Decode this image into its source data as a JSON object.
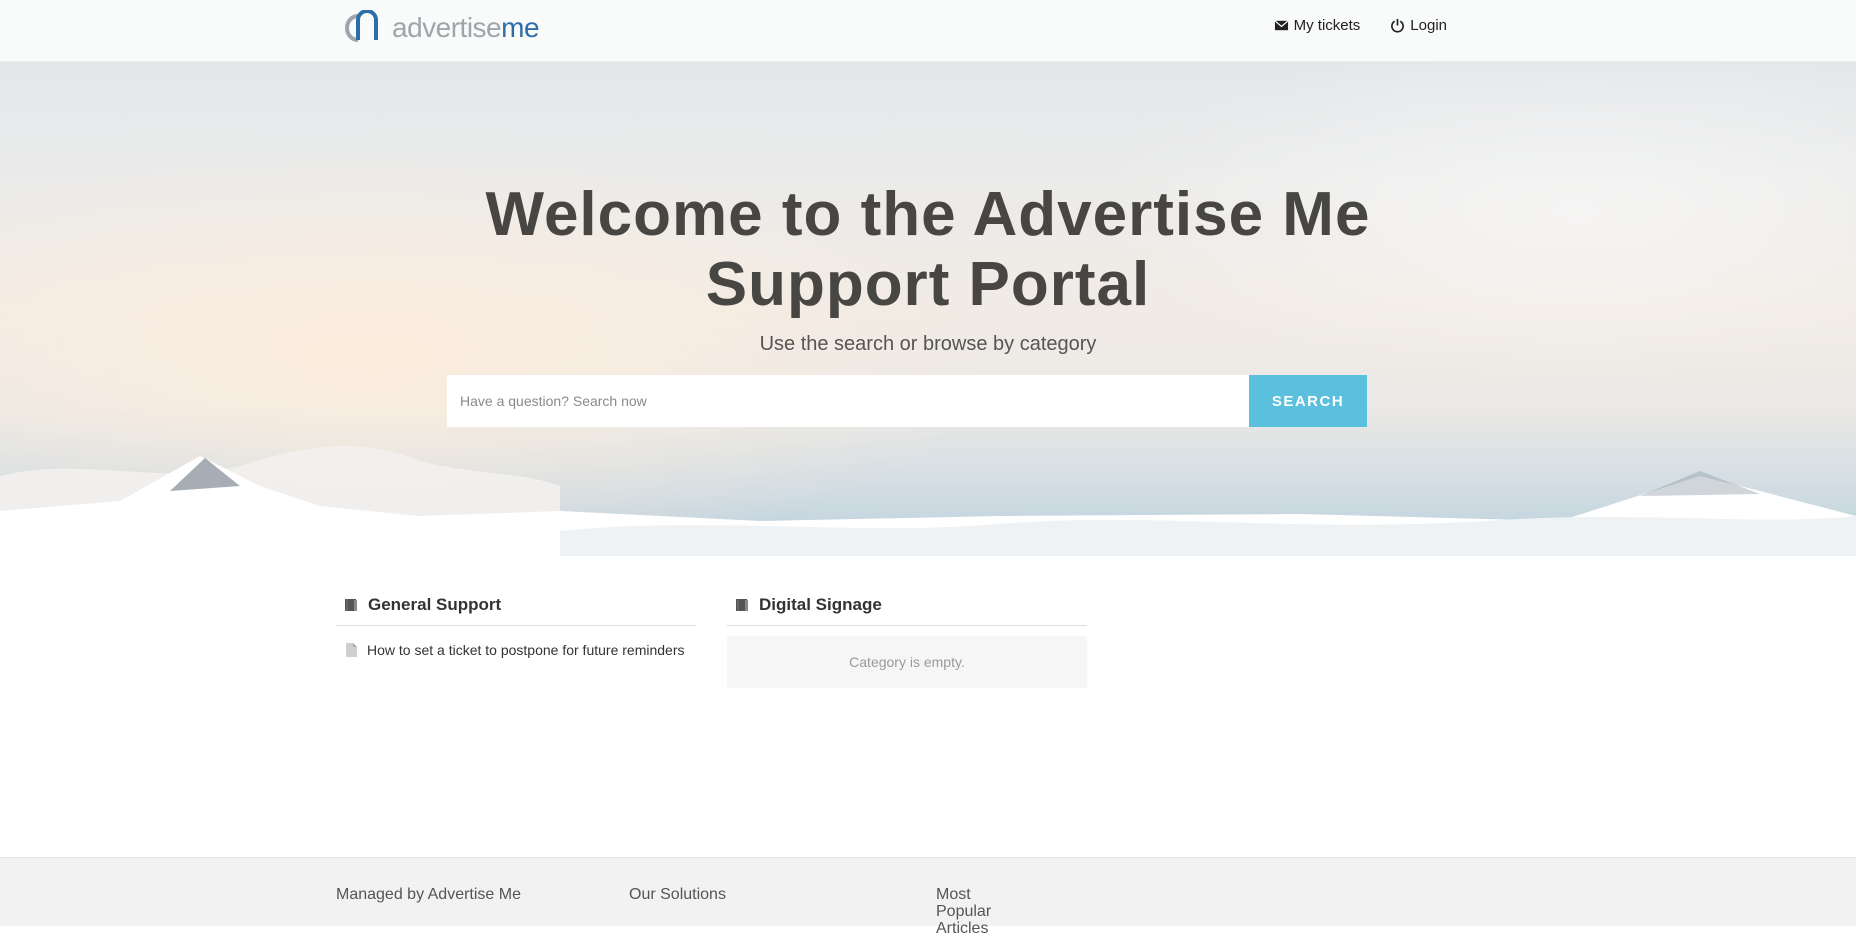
{
  "header": {
    "logo": {
      "text_light": "advertise",
      "text_bold": "me",
      "light_color": "#9ea5ab",
      "bold_color": "#2c6fa8"
    },
    "nav": [
      {
        "label": "My tickets",
        "icon": "envelope-icon"
      },
      {
        "label": "Login",
        "icon": "power-icon"
      }
    ]
  },
  "hero": {
    "title_line1": "Welcome to the Advertise Me",
    "title_line2": "Support Portal",
    "subtitle": "Use the search or browse by category",
    "search": {
      "placeholder": "Have a question? Search now",
      "button_label": "SEARCH",
      "button_color": "#5bc0de"
    }
  },
  "categories": [
    {
      "title": "General Support",
      "icon": "book-icon",
      "articles": [
        {
          "label": "How to set a ticket to postpone for future reminders",
          "icon": "document-icon"
        }
      ]
    },
    {
      "title": "Digital Signage",
      "icon": "book-icon",
      "empty_text": "Category is empty."
    }
  ],
  "footer": {
    "col1": "Managed by Advertise Me",
    "col2": "Our Solutions",
    "col3": "Most Popular Articles"
  }
}
